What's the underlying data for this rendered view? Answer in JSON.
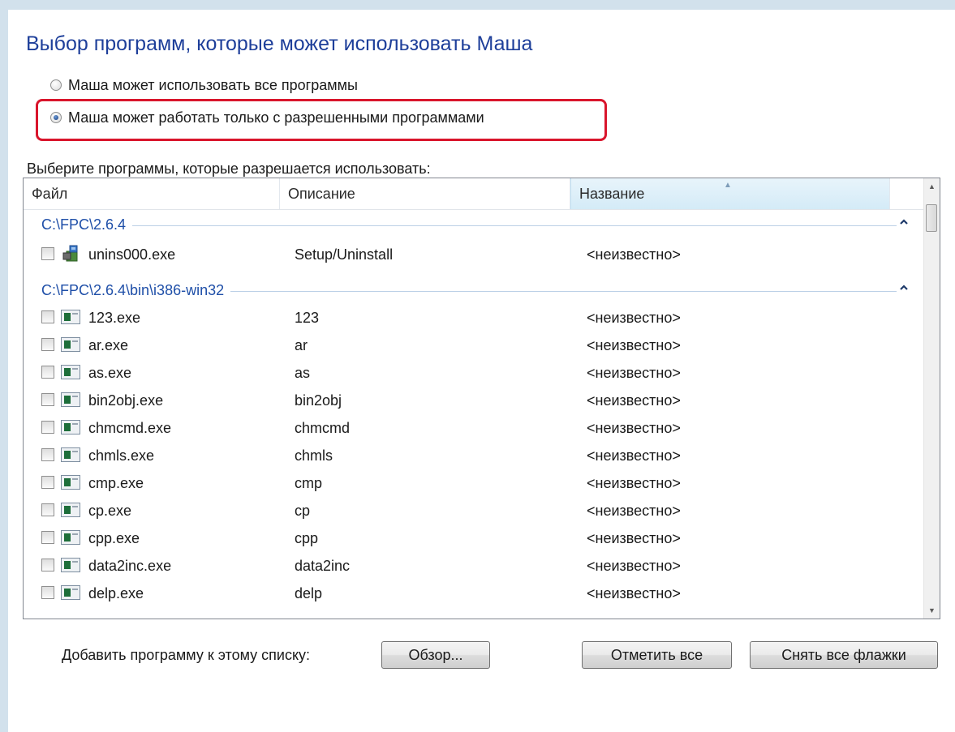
{
  "title": "Выбор программ, которые может использовать Маша",
  "options": [
    {
      "label": "Маша может использовать все программы",
      "checked": false
    },
    {
      "label": "Маша может работать только с разрешенными программами",
      "checked": true
    }
  ],
  "list_caption": "Выберите программы, которые разрешается использовать:",
  "columns": {
    "file": "Файл",
    "description": "Описание",
    "name": "Название"
  },
  "groups": [
    {
      "path": "C:\\FPC\\2.6.4",
      "items": [
        {
          "file": "unins000.exe",
          "description": "Setup/Uninstall",
          "name": "<неизвестно>",
          "icon": "setup-icon"
        }
      ]
    },
    {
      "path": "C:\\FPC\\2.6.4\\bin\\i386-win32",
      "items": [
        {
          "file": "123.exe",
          "description": "123",
          "name": "<неизвестно>",
          "icon": "exe-icon"
        },
        {
          "file": "ar.exe",
          "description": "ar",
          "name": "<неизвестно>",
          "icon": "exe-icon"
        },
        {
          "file": "as.exe",
          "description": "as",
          "name": "<неизвестно>",
          "icon": "exe-icon"
        },
        {
          "file": "bin2obj.exe",
          "description": "bin2obj",
          "name": "<неизвестно>",
          "icon": "exe-icon"
        },
        {
          "file": "chmcmd.exe",
          "description": "chmcmd",
          "name": "<неизвестно>",
          "icon": "exe-icon"
        },
        {
          "file": "chmls.exe",
          "description": "chmls",
          "name": "<неизвестно>",
          "icon": "exe-icon"
        },
        {
          "file": "cmp.exe",
          "description": "cmp",
          "name": "<неизвестно>",
          "icon": "exe-icon"
        },
        {
          "file": "cp.exe",
          "description": "cp",
          "name": "<неизвестно>",
          "icon": "exe-icon"
        },
        {
          "file": "cpp.exe",
          "description": "cpp",
          "name": "<неизвестно>",
          "icon": "exe-icon"
        },
        {
          "file": "data2inc.exe",
          "description": "data2inc",
          "name": "<неизвестно>",
          "icon": "exe-icon"
        },
        {
          "file": "delp.exe",
          "description": "delp",
          "name": "<неизвестно>",
          "icon": "exe-icon"
        }
      ]
    }
  ],
  "add_label": "Добавить программу к этому списку:",
  "buttons": {
    "browse": "Обзор...",
    "check_all": "Отметить все",
    "uncheck_all": "Снять все флажки"
  },
  "colors": {
    "title": "#1e3f9a",
    "group_text": "#1f4fa8",
    "highlight": "#d9152c",
    "background": "#d2e1ec"
  }
}
